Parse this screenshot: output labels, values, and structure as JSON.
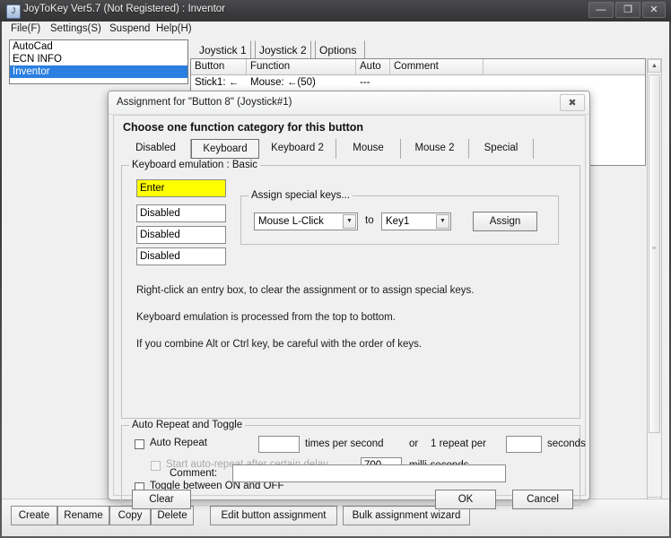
{
  "window": {
    "title": "JoyToKey Ver5.7 (Not Registered) : Inventor",
    "icon": "joystick-icon",
    "controls": {
      "minimize": "—",
      "maximize": "❐",
      "close": "✕"
    }
  },
  "menu": {
    "items": [
      {
        "label": "File(F)"
      },
      {
        "label": "Settings(S)"
      },
      {
        "label": "Suspend"
      },
      {
        "label": "Help(H)"
      }
    ]
  },
  "profiles": {
    "items": [
      {
        "label": "AutoCad",
        "selected": false
      },
      {
        "label": "ECN INFO",
        "selected": false
      },
      {
        "label": "Inventor",
        "selected": true
      }
    ]
  },
  "joystick_panel": {
    "tabs": [
      {
        "label": "Joystick 1",
        "active": true
      },
      {
        "label": "Joystick 2",
        "active": false
      },
      {
        "label": "Options",
        "active": false
      }
    ],
    "columns": [
      "Button",
      "Function",
      "Auto",
      "Comment"
    ],
    "rows": [
      {
        "button": "Stick1: ←",
        "function": "Mouse: ←(50)",
        "auto": "---",
        "comment": ""
      }
    ],
    "scrollbar": {
      "up": "▲",
      "down": "▼",
      "grip": "≡"
    }
  },
  "bottom_toolbar": {
    "buttons": [
      {
        "label": "Create"
      },
      {
        "label": "Rename"
      },
      {
        "label": "Copy"
      },
      {
        "label": "Delete"
      },
      {
        "label": "Edit button assignment"
      },
      {
        "label": "Bulk assignment wizard"
      }
    ]
  },
  "dialog": {
    "title": "Assignment for \"Button 8\" (Joystick#1)",
    "close_label": "✖",
    "heading": "Choose one function category for this button",
    "category_tabs": [
      {
        "label": "Disabled",
        "active": false
      },
      {
        "label": "Keyboard",
        "active": true
      },
      {
        "label": "Keyboard 2",
        "active": false
      },
      {
        "label": "Mouse",
        "active": false
      },
      {
        "label": "Mouse 2",
        "active": false
      },
      {
        "label": "Special",
        "active": false
      }
    ],
    "keyboard_group": {
      "title": "Keyboard emulation : Basic",
      "key_fields": [
        {
          "value": "Enter",
          "highlighted": true
        },
        {
          "value": "Disabled",
          "highlighted": false
        },
        {
          "value": "Disabled",
          "highlighted": false
        },
        {
          "value": "Disabled",
          "highlighted": false
        }
      ],
      "special_keys": {
        "title": "Assign special keys...",
        "source_value": "Mouse L-Click",
        "to_label": "to",
        "target_value": "Key1",
        "assign_label": "Assign",
        "arrow": "▼"
      },
      "hints": [
        "Right-click an entry box, to clear the assignment or to assign special keys.",
        "Keyboard emulation is processed from the top to bottom.",
        "If you combine Alt or Ctrl key, be careful with the order of keys."
      ]
    },
    "auto_repeat_group": {
      "title": "Auto Repeat and Toggle",
      "auto_repeat_label": "Auto Repeat",
      "auto_repeat_checked": false,
      "rate_value": "",
      "times_per_second_label": "times per second",
      "or_label": "or",
      "one_repeat_per_label": "1 repeat per",
      "seconds_value": "",
      "seconds_label": "seconds",
      "delay_label": "Start auto-repeat after certain delay",
      "delay_checked": false,
      "delay_disabled": true,
      "delay_value": "700",
      "milliseconds_label": "milli-seconds",
      "toggle_label": "Toggle between ON and OFF",
      "toggle_checked": false
    },
    "comment": {
      "label": "Comment:",
      "value": "",
      "placeholder": ""
    },
    "footer": {
      "clear_label": "Clear",
      "ok_label": "OK",
      "cancel_label": "Cancel"
    }
  },
  "colors": {
    "highlight_yellow": "#ffff00",
    "selection_blue": "#2a7fe0",
    "dialog_bg": "#f0f0f0"
  }
}
